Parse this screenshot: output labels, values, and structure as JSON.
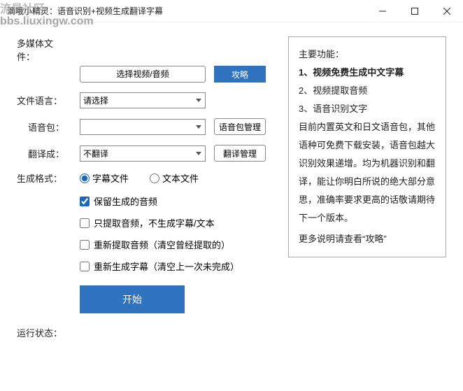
{
  "watermark": {
    "line1": "流星社区",
    "line2": "bbs.liuxingw.com"
  },
  "titlebar": {
    "title": "滴哦小精灵：语音识别+视频生成翻译字幕"
  },
  "labels": {
    "multimedia": "多媒体文件：",
    "file_lang": "文件语言：",
    "voice_pack": "语音包：",
    "translate_to": "翻译成：",
    "output_format": "生成格式：",
    "status": "运行状态："
  },
  "buttons": {
    "select_media": "选择视频/音频",
    "strategy": "攻略",
    "voice_manage": "语音包管理",
    "translate_manage": "翻译管理",
    "start": "开始"
  },
  "selects": {
    "file_lang_value": "请选择",
    "voice_pack_value": "",
    "translate_to_value": "不翻译"
  },
  "radios": {
    "subtitle": "字幕文件",
    "text": "文本文件"
  },
  "checkboxes": {
    "keep_audio": "保留生成的音频",
    "only_audio": "只提取音频，不生成字幕/文本",
    "re_extract": "重新提取音频（清空曾经提取的）",
    "re_subtitle": "重新生成字幕（清空上一次未完成）"
  },
  "panel": {
    "heading": "主要功能：",
    "item1": "1、视频免费生成中文字幕",
    "item2": "2、视频提取音频",
    "item3": "3、语音识别文字",
    "body": "目前内置英文和日文语音包，其他语种可免费下载安装，语音包越大识别效果递增。均为机器识别和翻译，能让你明白所说的绝大部分意思，准确率要求更高的话敬请期待下一个版本。",
    "footer": "更多说明请查看“攻略”"
  }
}
